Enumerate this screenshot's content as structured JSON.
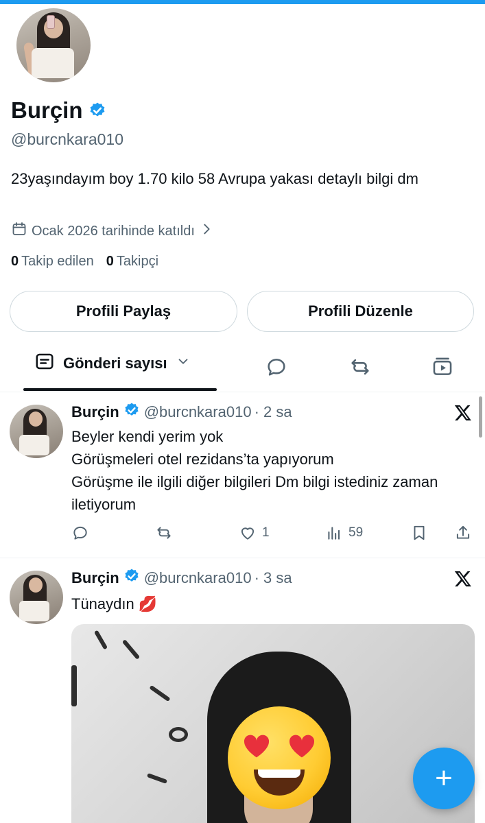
{
  "profile": {
    "name": "Burçin",
    "handle": "@burcnkara010",
    "bio": "23yaşındayım boy 1.70 kilo 58 Avrupa yakası detaylı bilgi dm",
    "joined": "Ocak 2026 tarihinde katıldı",
    "following_count": "0",
    "following_label": "Takip edilen",
    "followers_count": "0",
    "followers_label": "Takipçi"
  },
  "buttons": {
    "share": "Profili Paylaş",
    "edit": "Profili Düzenle"
  },
  "tabs": {
    "posts_label": "Gönderi sayısı"
  },
  "tweets": [
    {
      "name": "Burçin",
      "handle": "@burcnkara010",
      "time": "· 2 sa",
      "lines": [
        "Beyler kendi yerim yok",
        "Görüşmeleri otel rezidans’ta yapıyorum",
        "Görüşme ile ilgili diğer bilgileri Dm bilgi istediniz zaman iletiyorum"
      ],
      "likes": "1",
      "views": "59"
    },
    {
      "name": "Burçin",
      "handle": "@burcnkara010",
      "time": "· 3 sa",
      "text": "Tünaydın 💋"
    }
  ],
  "colors": {
    "accent": "#1d9bf0",
    "text": "#0f1419",
    "muted": "#536471",
    "border": "#cfd9de"
  },
  "icons": [
    "verified-badge-icon",
    "calendar-icon",
    "chevron-right-icon",
    "posts-icon",
    "chevron-down-icon",
    "reply-icon",
    "retweet-icon",
    "media-icon",
    "x-logo-icon",
    "like-icon",
    "views-icon",
    "bookmark-icon",
    "share-icon",
    "compose-plus-icon"
  ],
  "fab_label": "+"
}
